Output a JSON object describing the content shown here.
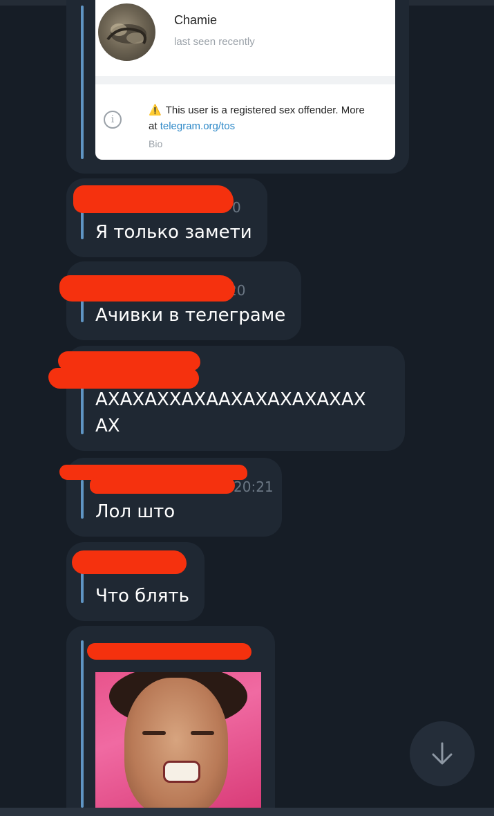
{
  "profile_card": {
    "name": "Chamie",
    "status": "last seen recently",
    "bio_text": "This user is a registered sex offender. More",
    "bio_at": "at",
    "bio_link": "telegram.org/tos",
    "bio_label": "Bio",
    "info_glyph": "i",
    "warning_glyph": "⚠️"
  },
  "messages": [
    {
      "text": "Я только замети",
      "time_fragment": "0"
    },
    {
      "text": "Ачивки в телеграме",
      "time_fragment": "20"
    },
    {
      "text_line1": "АХАХАХХАХААХАХАХАХАХАХ",
      "text_line2": "АХ"
    },
    {
      "text": "Лол што",
      "time": "20:21"
    },
    {
      "text": "Что блять"
    }
  ],
  "icons": {
    "scroll_down": "arrow-down-icon"
  },
  "colors": {
    "background": "#161d26",
    "bubble": "#1f2833",
    "accent": "#5f95c4",
    "redaction": "#f5310e"
  }
}
